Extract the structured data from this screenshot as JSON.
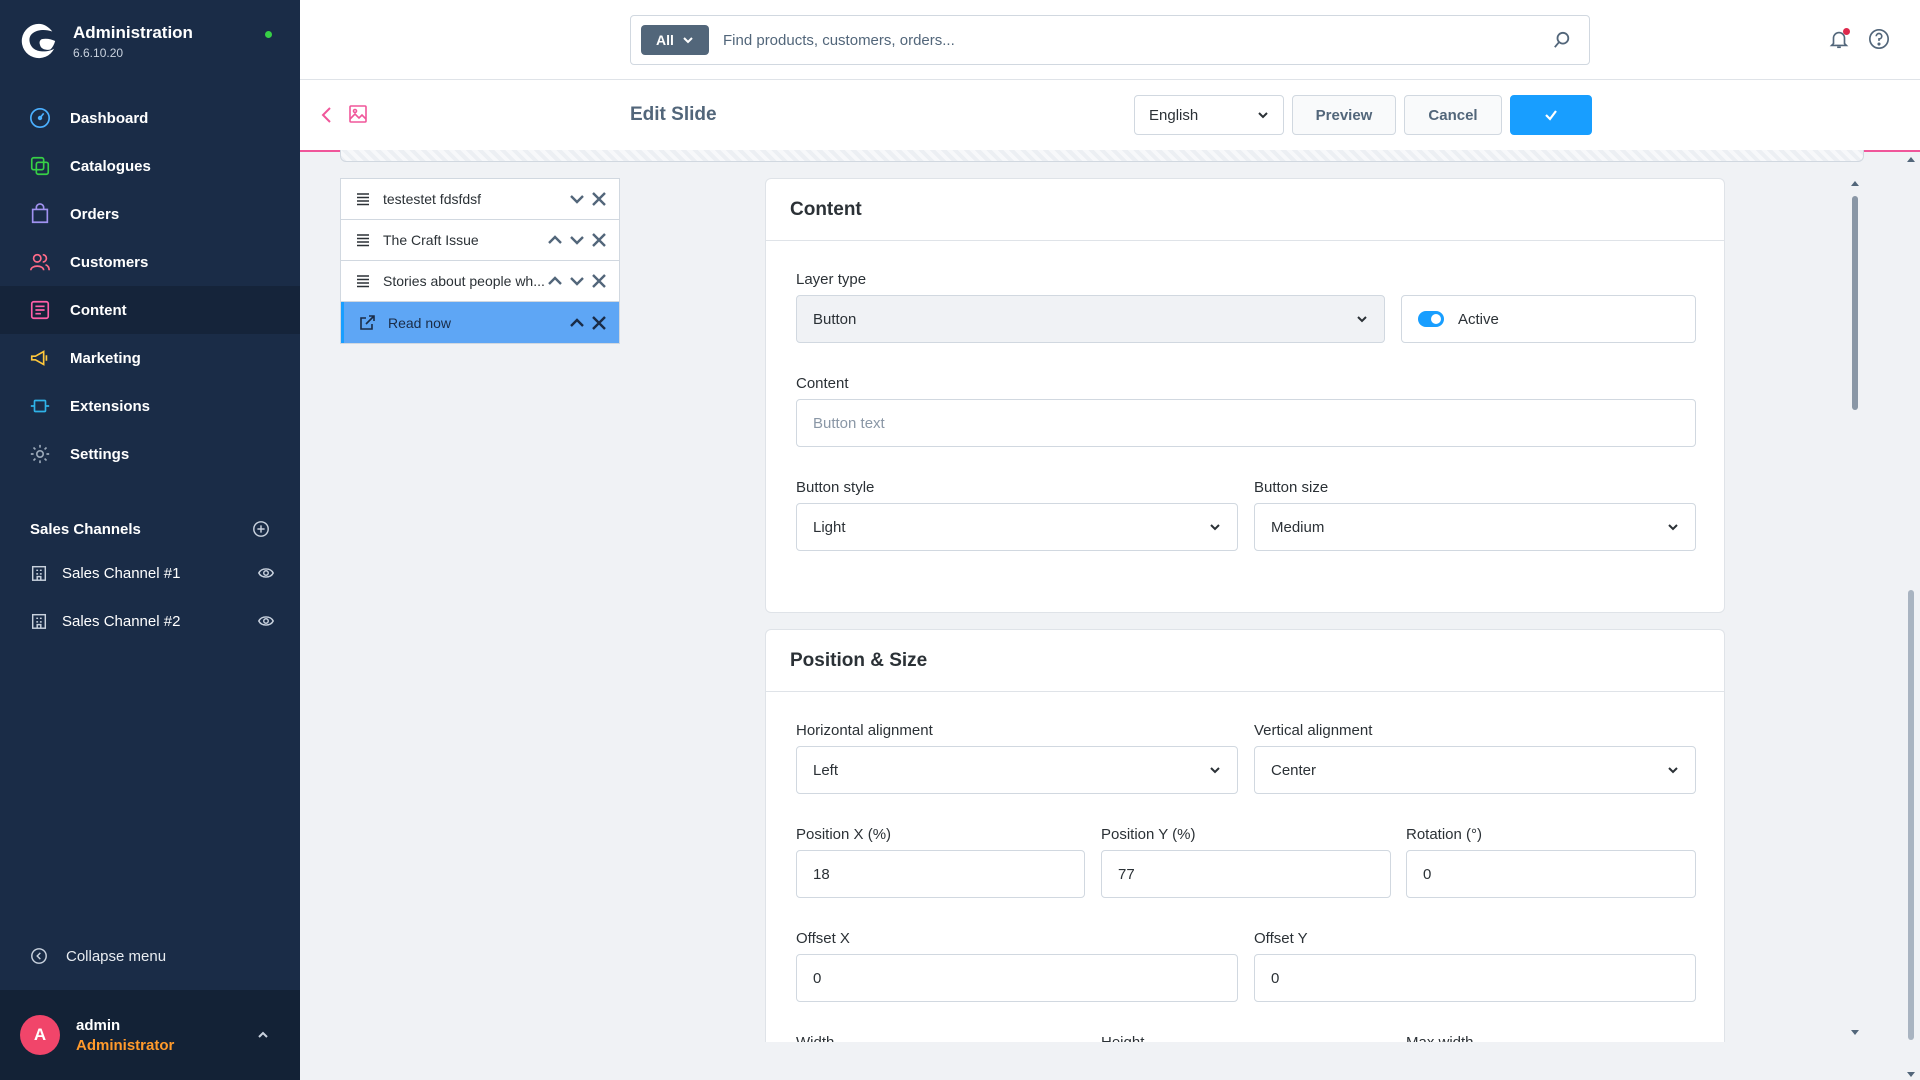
{
  "app": {
    "title": "Administration",
    "version": "6.6.10.20"
  },
  "sidebar": {
    "items": [
      {
        "label": "Dashboard",
        "icon": "dashboard-icon"
      },
      {
        "label": "Catalogues",
        "icon": "catalogue-icon"
      },
      {
        "label": "Orders",
        "icon": "orders-icon"
      },
      {
        "label": "Customers",
        "icon": "customers-icon"
      },
      {
        "label": "Content",
        "icon": "content-icon",
        "active": true
      },
      {
        "label": "Marketing",
        "icon": "marketing-icon"
      },
      {
        "label": "Extensions",
        "icon": "extensions-icon"
      },
      {
        "label": "Settings",
        "icon": "settings-icon"
      }
    ],
    "sales_channels_title": "Sales Channels",
    "sales_channels": [
      "Sales Channel #1",
      "Sales Channel #2"
    ],
    "collapse_label": "Collapse menu",
    "user": {
      "initial": "A",
      "name": "admin",
      "role": "Administrator"
    }
  },
  "search": {
    "type_label": "All",
    "placeholder": "Find products, customers, orders..."
  },
  "smartbar": {
    "title": "Edit Slide",
    "language": "English",
    "preview_label": "Preview",
    "cancel_label": "Cancel"
  },
  "layers": [
    {
      "label": "testestet fdsfdsf",
      "icon": "text-icon",
      "up": false,
      "down": true
    },
    {
      "label": "The Craft Issue",
      "icon": "text-icon",
      "up": true,
      "down": true
    },
    {
      "label": "Stories about people wh...",
      "icon": "text-icon",
      "up": true,
      "down": true
    },
    {
      "label": "Read now",
      "icon": "external-link-icon",
      "up": true,
      "down": false,
      "selected": true
    }
  ],
  "content_card": {
    "title": "Content",
    "layer_type_label": "Layer type",
    "layer_type_value": "Button",
    "active_label": "Active",
    "content_label": "Content",
    "content_placeholder": "Button text",
    "button_style_label": "Button style",
    "button_style_value": "Light",
    "button_size_label": "Button size",
    "button_size_value": "Medium"
  },
  "position_card": {
    "title": "Position & Size",
    "h_align_label": "Horizontal alignment",
    "h_align_value": "Left",
    "v_align_label": "Vertical alignment",
    "v_align_value": "Center",
    "pos_x_label": "Position X (%)",
    "pos_x_value": "18",
    "pos_y_label": "Position Y (%)",
    "pos_y_value": "77",
    "rotation_label": "Rotation (°)",
    "rotation_value": "0",
    "offset_x_label": "Offset X",
    "offset_x_value": "0",
    "offset_y_label": "Offset Y",
    "offset_y_value": "0",
    "width_label": "Width",
    "height_label": "Height",
    "max_width_label": "Max width"
  },
  "colors": {
    "sidebar_bg": "#1a2c47",
    "accent": "#189eff",
    "highlight_border": "#f0569a",
    "status_online": "#37d046",
    "avatar_bg": "#f1456a",
    "role_color": "#ff9a2b"
  }
}
